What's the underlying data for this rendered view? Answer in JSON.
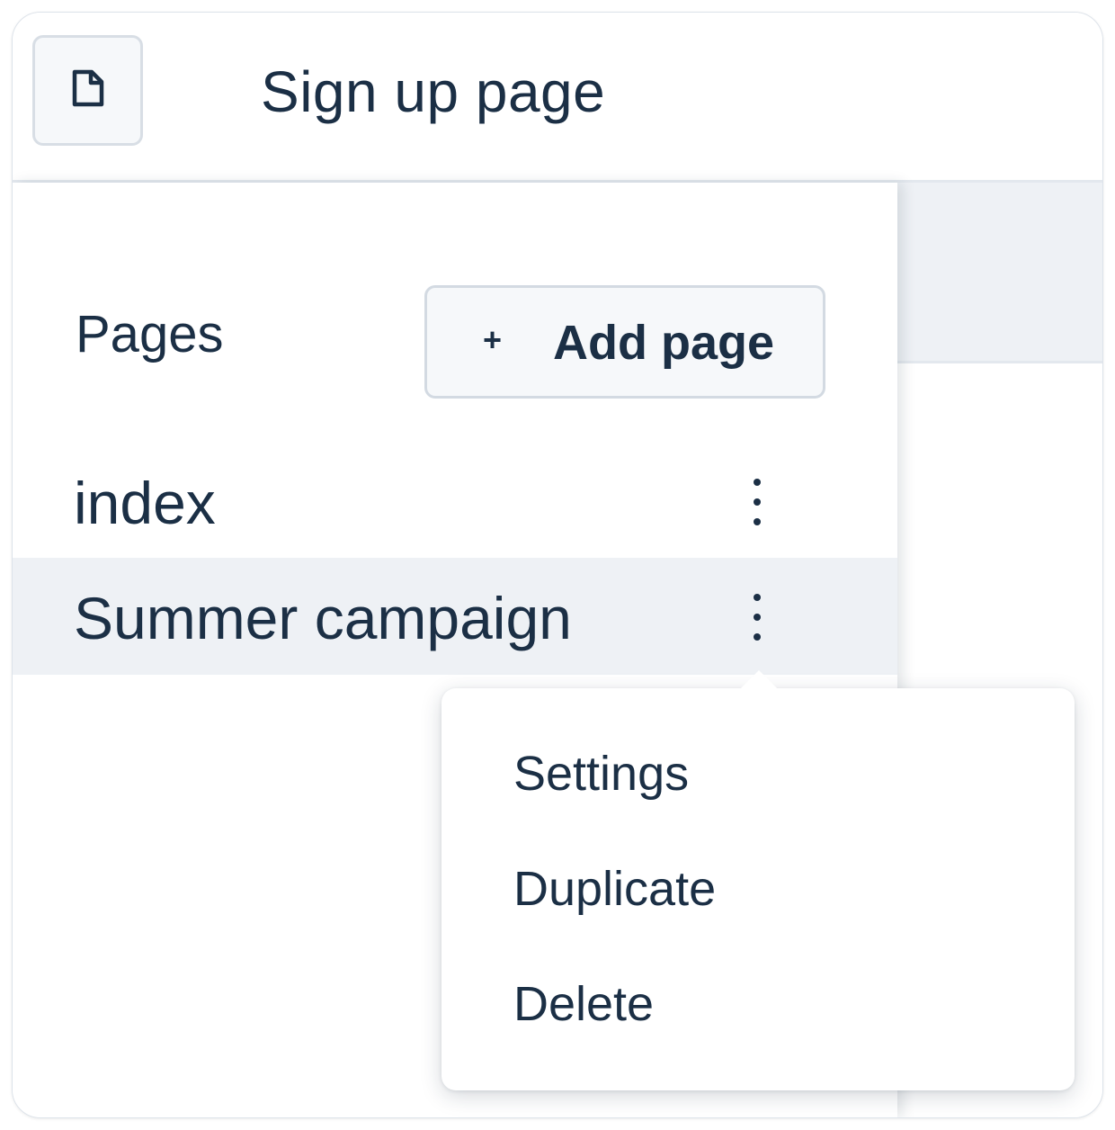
{
  "header": {
    "icon": "file-icon",
    "title": "Sign up page"
  },
  "sidebar": {
    "heading": "Pages",
    "add_button": {
      "icon": "plus",
      "plus_glyph": "+",
      "label": "Add page"
    },
    "pages": [
      {
        "name": "index",
        "selected": false,
        "menu_icon": "kebab-icon"
      },
      {
        "name": "Summer campaign",
        "selected": true,
        "menu_icon": "kebab-icon"
      }
    ]
  },
  "context_menu": {
    "items": [
      {
        "label": "Settings"
      },
      {
        "label": "Duplicate"
      },
      {
        "label": "Delete"
      }
    ]
  },
  "colors": {
    "text": "#1b2f45",
    "selected_row": "#eef1f5",
    "border": "#d3dae2"
  }
}
